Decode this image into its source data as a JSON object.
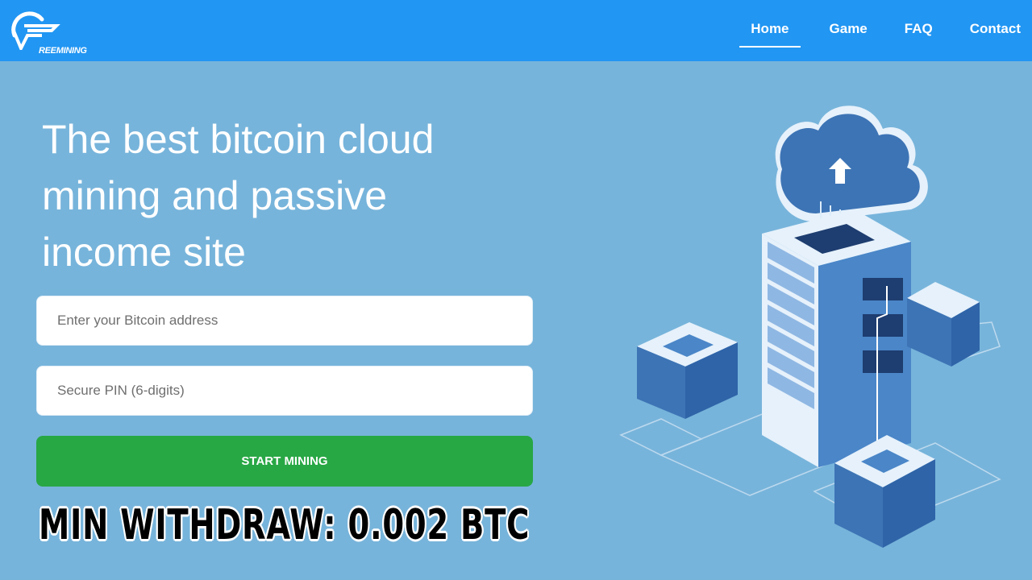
{
  "header": {
    "logo_text": "REEMINING",
    "nav": [
      {
        "label": "Home",
        "active": true
      },
      {
        "label": "Game",
        "active": false
      },
      {
        "label": "FAQ",
        "active": false
      },
      {
        "label": "Contact",
        "active": false
      }
    ]
  },
  "hero": {
    "headline": "The best bitcoin cloud mining and passive income site"
  },
  "form": {
    "address_placeholder": "Enter your Bitcoin address",
    "address_value": "",
    "pin_placeholder": "Secure PIN (6-digits)",
    "pin_value": "",
    "submit_label": "START MINING"
  },
  "overlay": {
    "min_withdraw": "MIN WITHDRAW: 0.002 BTC"
  },
  "colors": {
    "navbar": "#2196f3",
    "background": "#77b4db",
    "button": "#28a745"
  },
  "illustration": {
    "icon": "cloud-server-isometric-illustration"
  }
}
